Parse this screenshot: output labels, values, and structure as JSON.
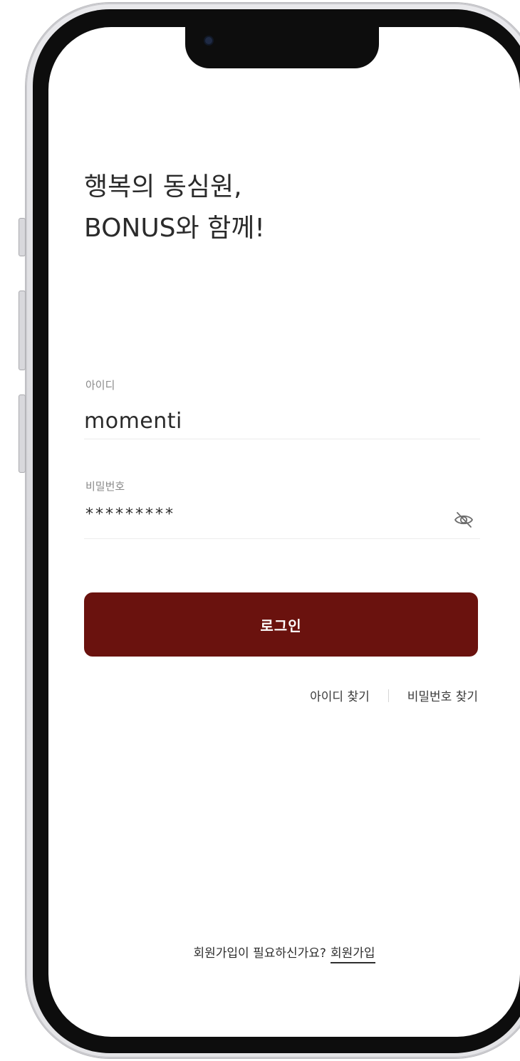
{
  "headline": {
    "line1": "행복의 동심원,",
    "line2": "BONUS와 함께!"
  },
  "id_field": {
    "label": "아이디",
    "value": "momenti"
  },
  "password_field": {
    "label": "비밀번호",
    "value": "*********",
    "toggle_icon": "eye-off-icon"
  },
  "login_button": {
    "label": "로그인",
    "color": "#6a120e"
  },
  "find_links": {
    "find_id": "아이디 찾기",
    "find_password": "비밀번호 찾기"
  },
  "signup": {
    "prompt": "회원가입이 필요하신가요?",
    "link": "회원가입"
  }
}
